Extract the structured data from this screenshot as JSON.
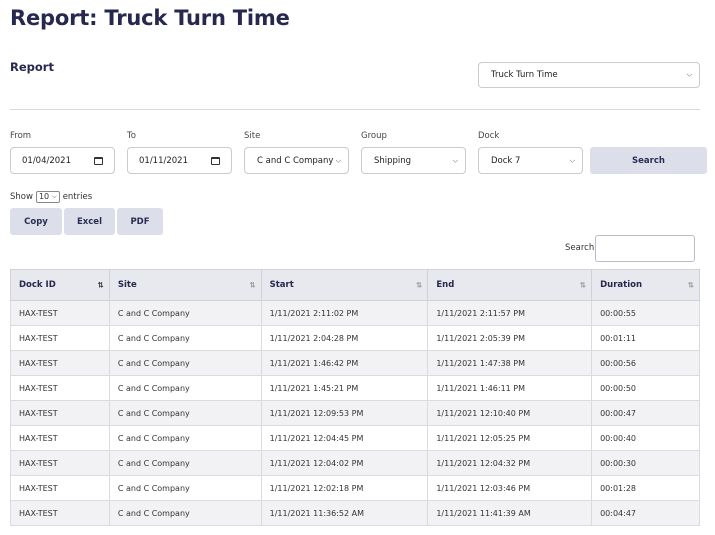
{
  "page": {
    "title": "Report: Truck Turn Time",
    "subtitle": "Report",
    "report_select": "Truck Turn Time"
  },
  "filters": {
    "from": {
      "label": "From",
      "value": "01/04/2021"
    },
    "to": {
      "label": "To",
      "value": "01/11/2021"
    },
    "site": {
      "label": "Site",
      "value": "C and C Company"
    },
    "group": {
      "label": "Group",
      "value": "Shipping"
    },
    "dock": {
      "label": "Dock",
      "value": "Dock 7"
    },
    "search_button": "Search"
  },
  "table_controls": {
    "show_label": "Show",
    "entries_value": "10",
    "entries_label": "entries",
    "copy_button": "Copy",
    "excel_button": "Excel",
    "pdf_button": "PDF",
    "search_label": "Search:",
    "search_value": ""
  },
  "table": {
    "columns": [
      "Dock ID",
      "Site",
      "Start",
      "End",
      "Duration"
    ],
    "sort_icon": "⇅",
    "rows": [
      [
        "HAX-TEST",
        "C and C Company",
        "1/11/2021 2:11:02 PM",
        "1/11/2021 2:11:57 PM",
        "00:00:55"
      ],
      [
        "HAX-TEST",
        "C and C Company",
        "1/11/2021 2:04:28 PM",
        "1/11/2021 2:05:39 PM",
        "00:01:11"
      ],
      [
        "HAX-TEST",
        "C and C Company",
        "1/11/2021 1:46:42 PM",
        "1/11/2021 1:47:38 PM",
        "00:00:56"
      ],
      [
        "HAX-TEST",
        "C and C Company",
        "1/11/2021 1:45:21 PM",
        "1/11/2021 1:46:11 PM",
        "00:00:50"
      ],
      [
        "HAX-TEST",
        "C and C Company",
        "1/11/2021 12:09:53 PM",
        "1/11/2021 12:10:40 PM",
        "00:00:47"
      ],
      [
        "HAX-TEST",
        "C and C Company",
        "1/11/2021 12:04:45 PM",
        "1/11/2021 12:05:25 PM",
        "00:00:40"
      ],
      [
        "HAX-TEST",
        "C and C Company",
        "1/11/2021 12:04:02 PM",
        "1/11/2021 12:04:32 PM",
        "00:00:30"
      ],
      [
        "HAX-TEST",
        "C and C Company",
        "1/11/2021 12:02:18 PM",
        "1/11/2021 12:03:46 PM",
        "00:01:28"
      ],
      [
        "HAX-TEST",
        "C and C Company",
        "1/11/2021 11:36:52 AM",
        "1/11/2021 11:41:39 AM",
        "00:04:47"
      ]
    ]
  }
}
